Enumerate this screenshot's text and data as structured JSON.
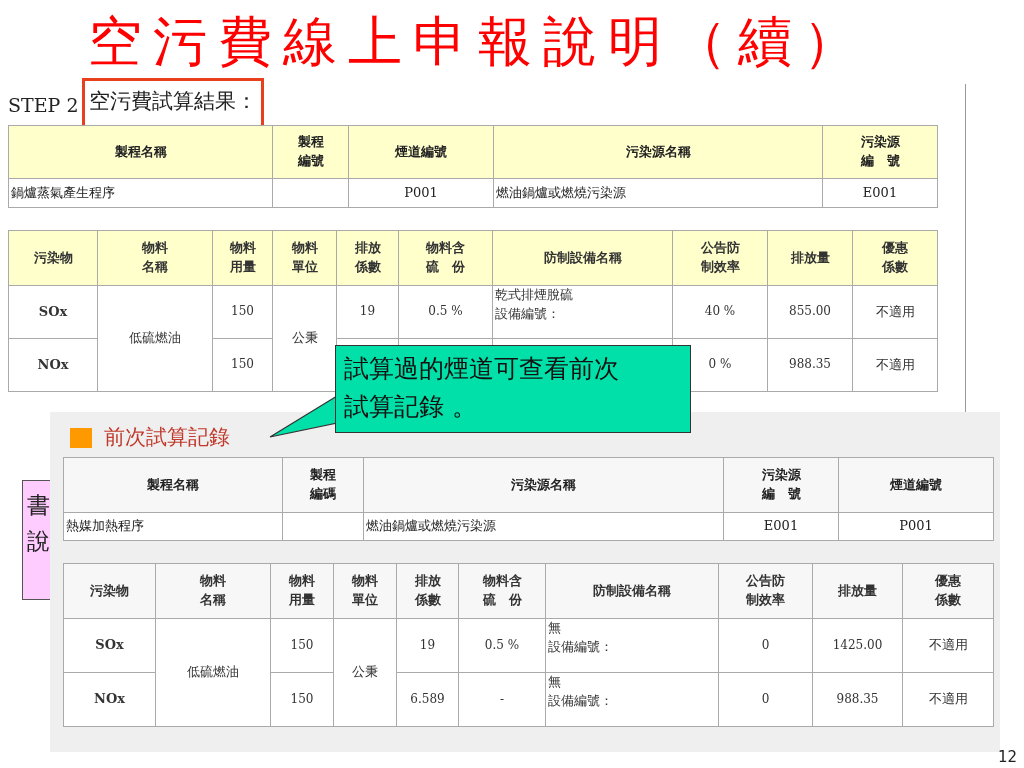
{
  "title": "空污費線上申報說明（續）",
  "step": {
    "label": "STEP 2",
    "heading": "空污費試算結果："
  },
  "result": {
    "process_table": {
      "columns": [
        "製程名稱",
        "製程編號",
        "煙道編號",
        "污染源名稱",
        "污染源編　號"
      ],
      "rows": [
        [
          "鍋爐蒸氣產生程序",
          "",
          "P001",
          "燃油鍋爐或燃燒污染源",
          "E001"
        ]
      ]
    },
    "pollutant_table": {
      "columns": [
        "污染物",
        "物料名稱",
        "物料用量",
        "物料單位",
        "排放係數",
        "物料含硫　份",
        "防制設備名稱",
        "公告防制效率",
        "排放量",
        "優惠係數"
      ],
      "material": "低硫燃油",
      "unit": "公秉",
      "rows": [
        {
          "pollutant": "SOx",
          "amount": "150",
          "factor": "19",
          "sulfur": "0.5 %",
          "equipment": [
            "乾式排煙脫硫",
            "設備編號："
          ],
          "efficiency": "40 %",
          "emission": "855.00",
          "discount": "不適用"
        },
        {
          "pollutant": "NOx",
          "amount": "150",
          "efficiency": "0 %",
          "emission": "988.35",
          "discount": "不適用"
        }
      ]
    }
  },
  "callout": "試算過的煙道可查看前次試算記錄 。",
  "side_note": [
    "書",
    "說"
  ],
  "previous": {
    "heading": "前次試算記錄",
    "process_table": {
      "columns": [
        "製程名稱",
        "製程編碼",
        "污染源名稱",
        "污染源編　號",
        "煙道編號"
      ],
      "rows": [
        [
          "熱媒加熱程序",
          "",
          "燃油鍋爐或燃燒污染源",
          "E001",
          "P001"
        ]
      ]
    },
    "pollutant_table": {
      "columns": [
        "污染物",
        "物料名稱",
        "物料用量",
        "物料單位",
        "排放係數",
        "物料含硫　份",
        "防制設備名稱",
        "公告防制效率",
        "排放量",
        "優惠係數"
      ],
      "material": "低硫燃油",
      "unit": "公秉",
      "rows": [
        {
          "pollutant": "SOx",
          "amount": "150",
          "factor": "19",
          "sulfur": "0.5 %",
          "equipment": [
            "無",
            "設備編號："
          ],
          "efficiency": "0",
          "emission": "1425.00",
          "discount": "不適用"
        },
        {
          "pollutant": "NOx",
          "amount": "150",
          "factor": "6.589",
          "sulfur": "-",
          "equipment": [
            "無",
            "設備編號："
          ],
          "efficiency": "0",
          "emission": "988.35",
          "discount": "不適用"
        }
      ]
    }
  },
  "page_number": "12"
}
